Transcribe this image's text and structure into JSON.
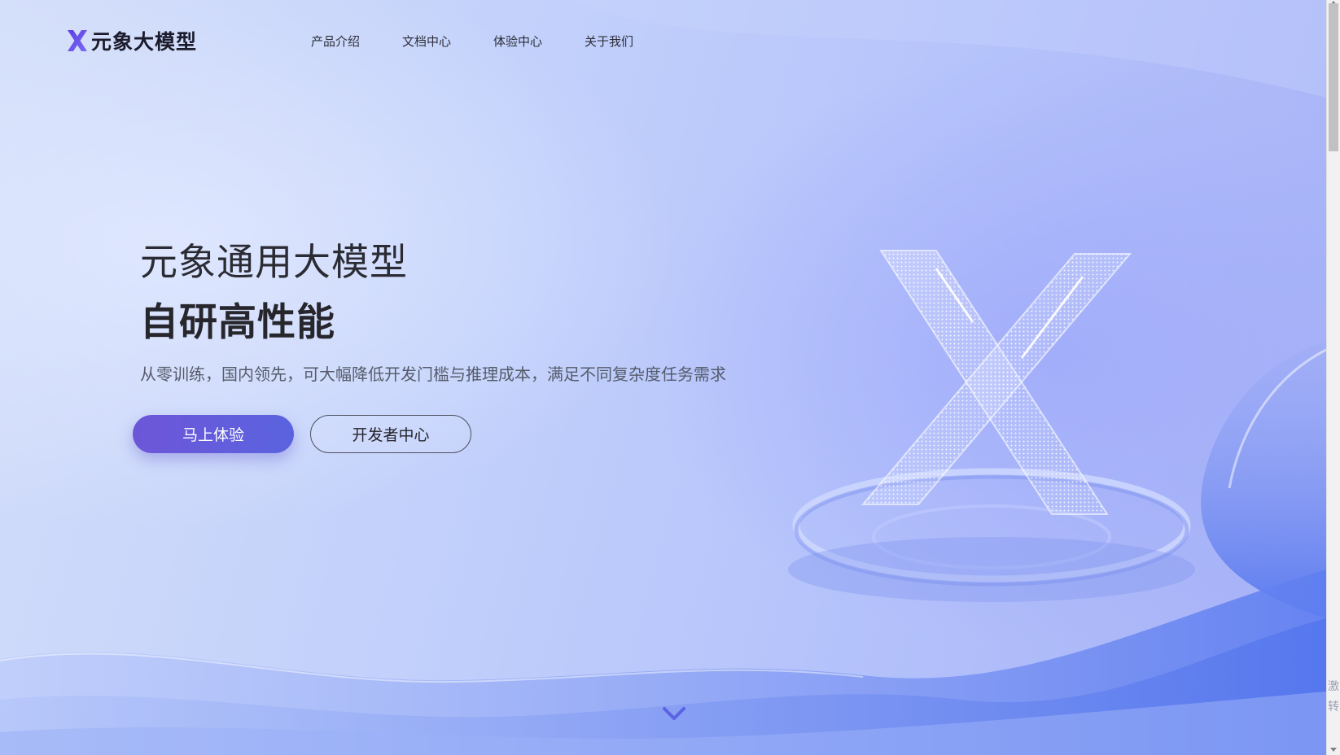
{
  "header": {
    "logo_text": "元象大模型",
    "nav": [
      "产品介绍",
      "文档中心",
      "体验中心",
      "关于我们"
    ]
  },
  "hero": {
    "title": "元象通用大模型",
    "headline": "自研高性能",
    "description": "从零训练，国内领先，可大幅降低开发门槛与推理成本，满足不同复杂度任务需求",
    "primary_button": "马上体验",
    "secondary_button": "开发者中心"
  },
  "side_tab": [
    "激",
    "转"
  ],
  "icons": {
    "logo": "x-logo-icon",
    "scroll_down": "chevron-down-icon",
    "hero_visual": "x-3d-emblem"
  },
  "colors": {
    "brand_purple": "#6d56d8",
    "brand_blue": "#5a63df",
    "logo_gradient_start": "#5b3ee6",
    "logo_gradient_end": "#7b6bf0"
  }
}
